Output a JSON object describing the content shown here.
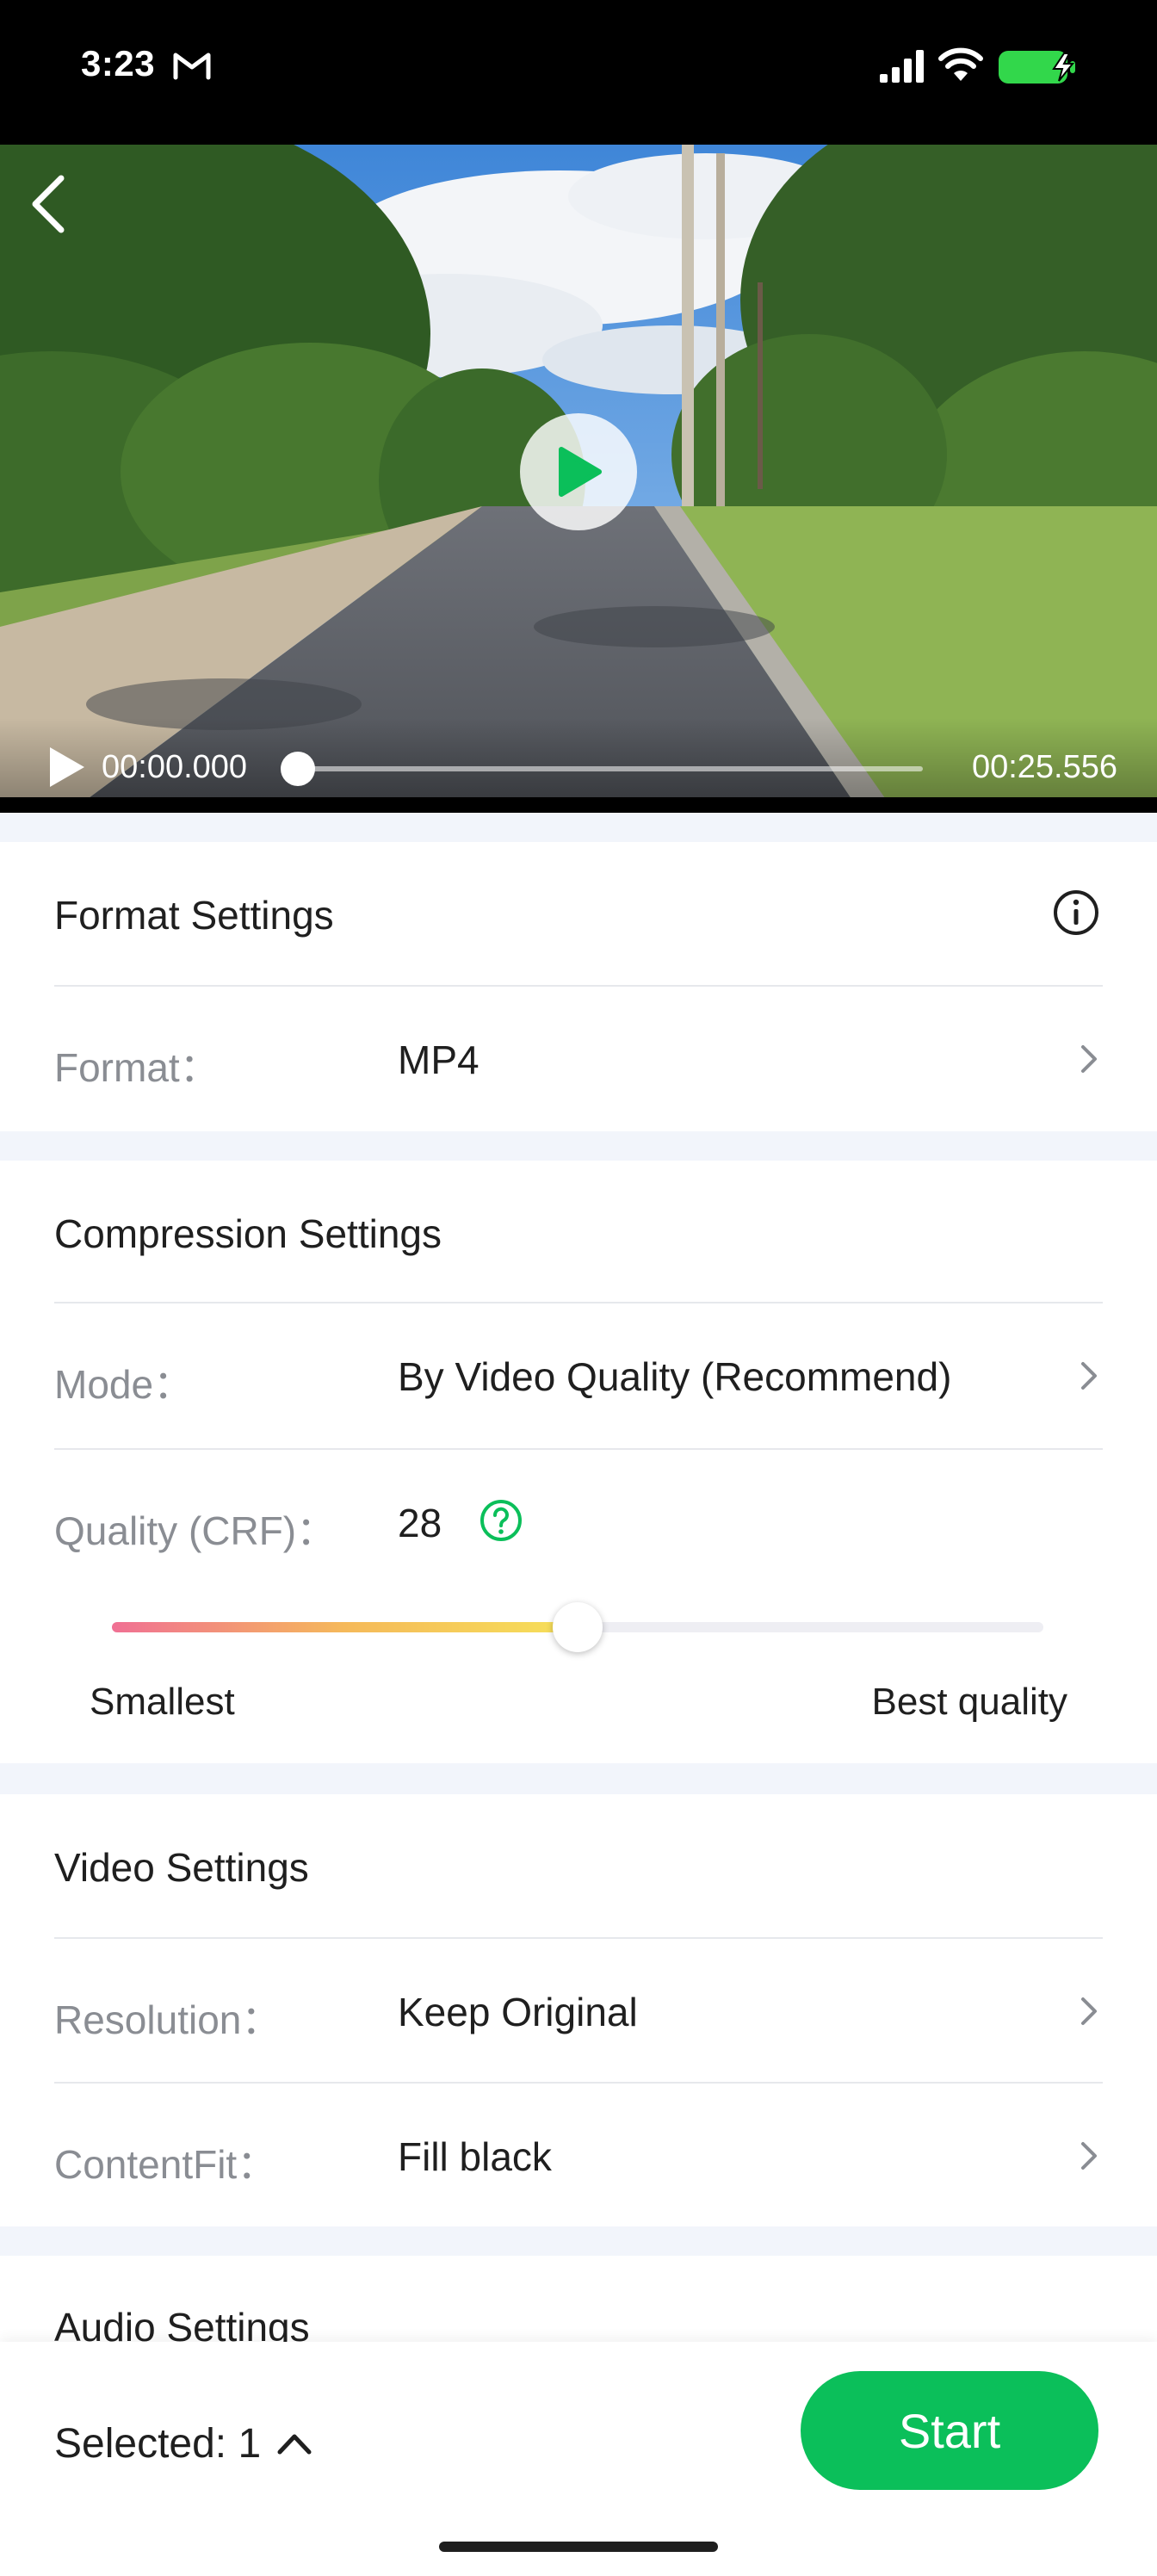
{
  "status_bar": {
    "time": "3:23",
    "icons": [
      "gmail-icon",
      "signal-icon",
      "wifi-icon",
      "battery-charging-icon"
    ],
    "battery_color": "#32d74b"
  },
  "video": {
    "current_time": "00:00.000",
    "total_time": "00:25.556",
    "progress": 0,
    "icons": [
      "back-icon",
      "play-icon"
    ]
  },
  "format_settings": {
    "title": "Format Settings",
    "format_label": "Format：",
    "format_value": "MP4"
  },
  "compression_settings": {
    "title": "Compression Settings",
    "mode_label": "Mode：",
    "mode_value": "By Video Quality (Recommend)",
    "quality_label": "Quality (CRF)：",
    "quality_value": "28",
    "slider_level": 0.5,
    "slider_min_label": "Smallest",
    "slider_max_label": "Best quality"
  },
  "video_settings": {
    "title": "Video Settings",
    "resolution_label": "Resolution：",
    "resolution_value": "Keep Original",
    "contentfit_label": "ContentFit：",
    "contentfit_value": "Fill black"
  },
  "audio_settings": {
    "title": "Audio Settings"
  },
  "bottom": {
    "selected": "Selected: 1",
    "start": "Start"
  },
  "colors": {
    "accent": "#0bbf5a",
    "page_background": "#f2f5fb",
    "label_gray": "#8a8d93"
  }
}
